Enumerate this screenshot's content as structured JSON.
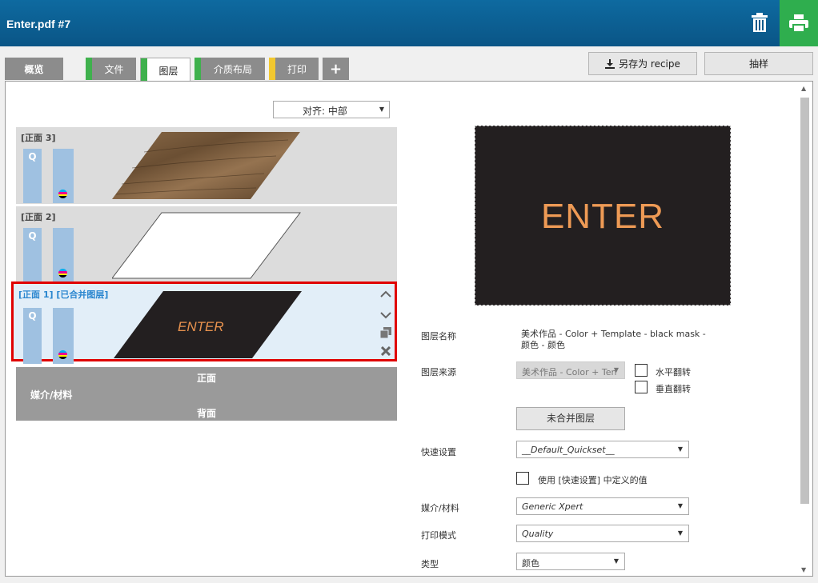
{
  "window": {
    "title": "Enter.pdf #7"
  },
  "tabs": [
    {
      "label": "概览",
      "stripe": ""
    },
    {
      "label": "文件",
      "stripe": "#3fb14d"
    },
    {
      "label": "图层",
      "stripe": "#3fb14d"
    },
    {
      "label": "介质布局",
      "stripe": "#3fb14d"
    },
    {
      "label": "打印",
      "stripe": "#f2c82f"
    },
    {
      "label": "+"
    }
  ],
  "toolbar": {
    "save_recipe": "另存为 recipe",
    "sample": "抽样"
  },
  "align": {
    "value": "对齐: 中部"
  },
  "layers": [
    {
      "name": "[正面 3]",
      "q": "Q"
    },
    {
      "name": "[正面 2]",
      "q": "Q"
    },
    {
      "name": "[正面 1] [已合并图层]",
      "q": "Q",
      "thumb_text": "ENTER"
    }
  ],
  "media": {
    "front": "正面",
    "material": "媒介/材料",
    "back": "背面"
  },
  "preview": {
    "text": "ENTER"
  },
  "properties": {
    "layer_name_label": "图层名称",
    "layer_name_value_line1": "美术作品 - Color + Template - black mask -",
    "layer_name_value_line2": "颜色 - 颜色",
    "layer_source_label": "图层来源",
    "layer_source_value": "美术作品 - Color + Ten",
    "flip_horizontal": "水平翻转",
    "flip_vertical": "垂直翻转",
    "unmerge": "未合并图层",
    "quickset_label": "快速设置",
    "quickset_value": "__Default_Quickset__",
    "use_quickset": "使用 [快速设置] 中定义的值",
    "media_label": "媒介/材料",
    "media_value": "Generic Xpert",
    "print_mode_label": "打印模式",
    "print_mode_value": "Quality",
    "type_label": "类型",
    "type_value": "颜色"
  }
}
